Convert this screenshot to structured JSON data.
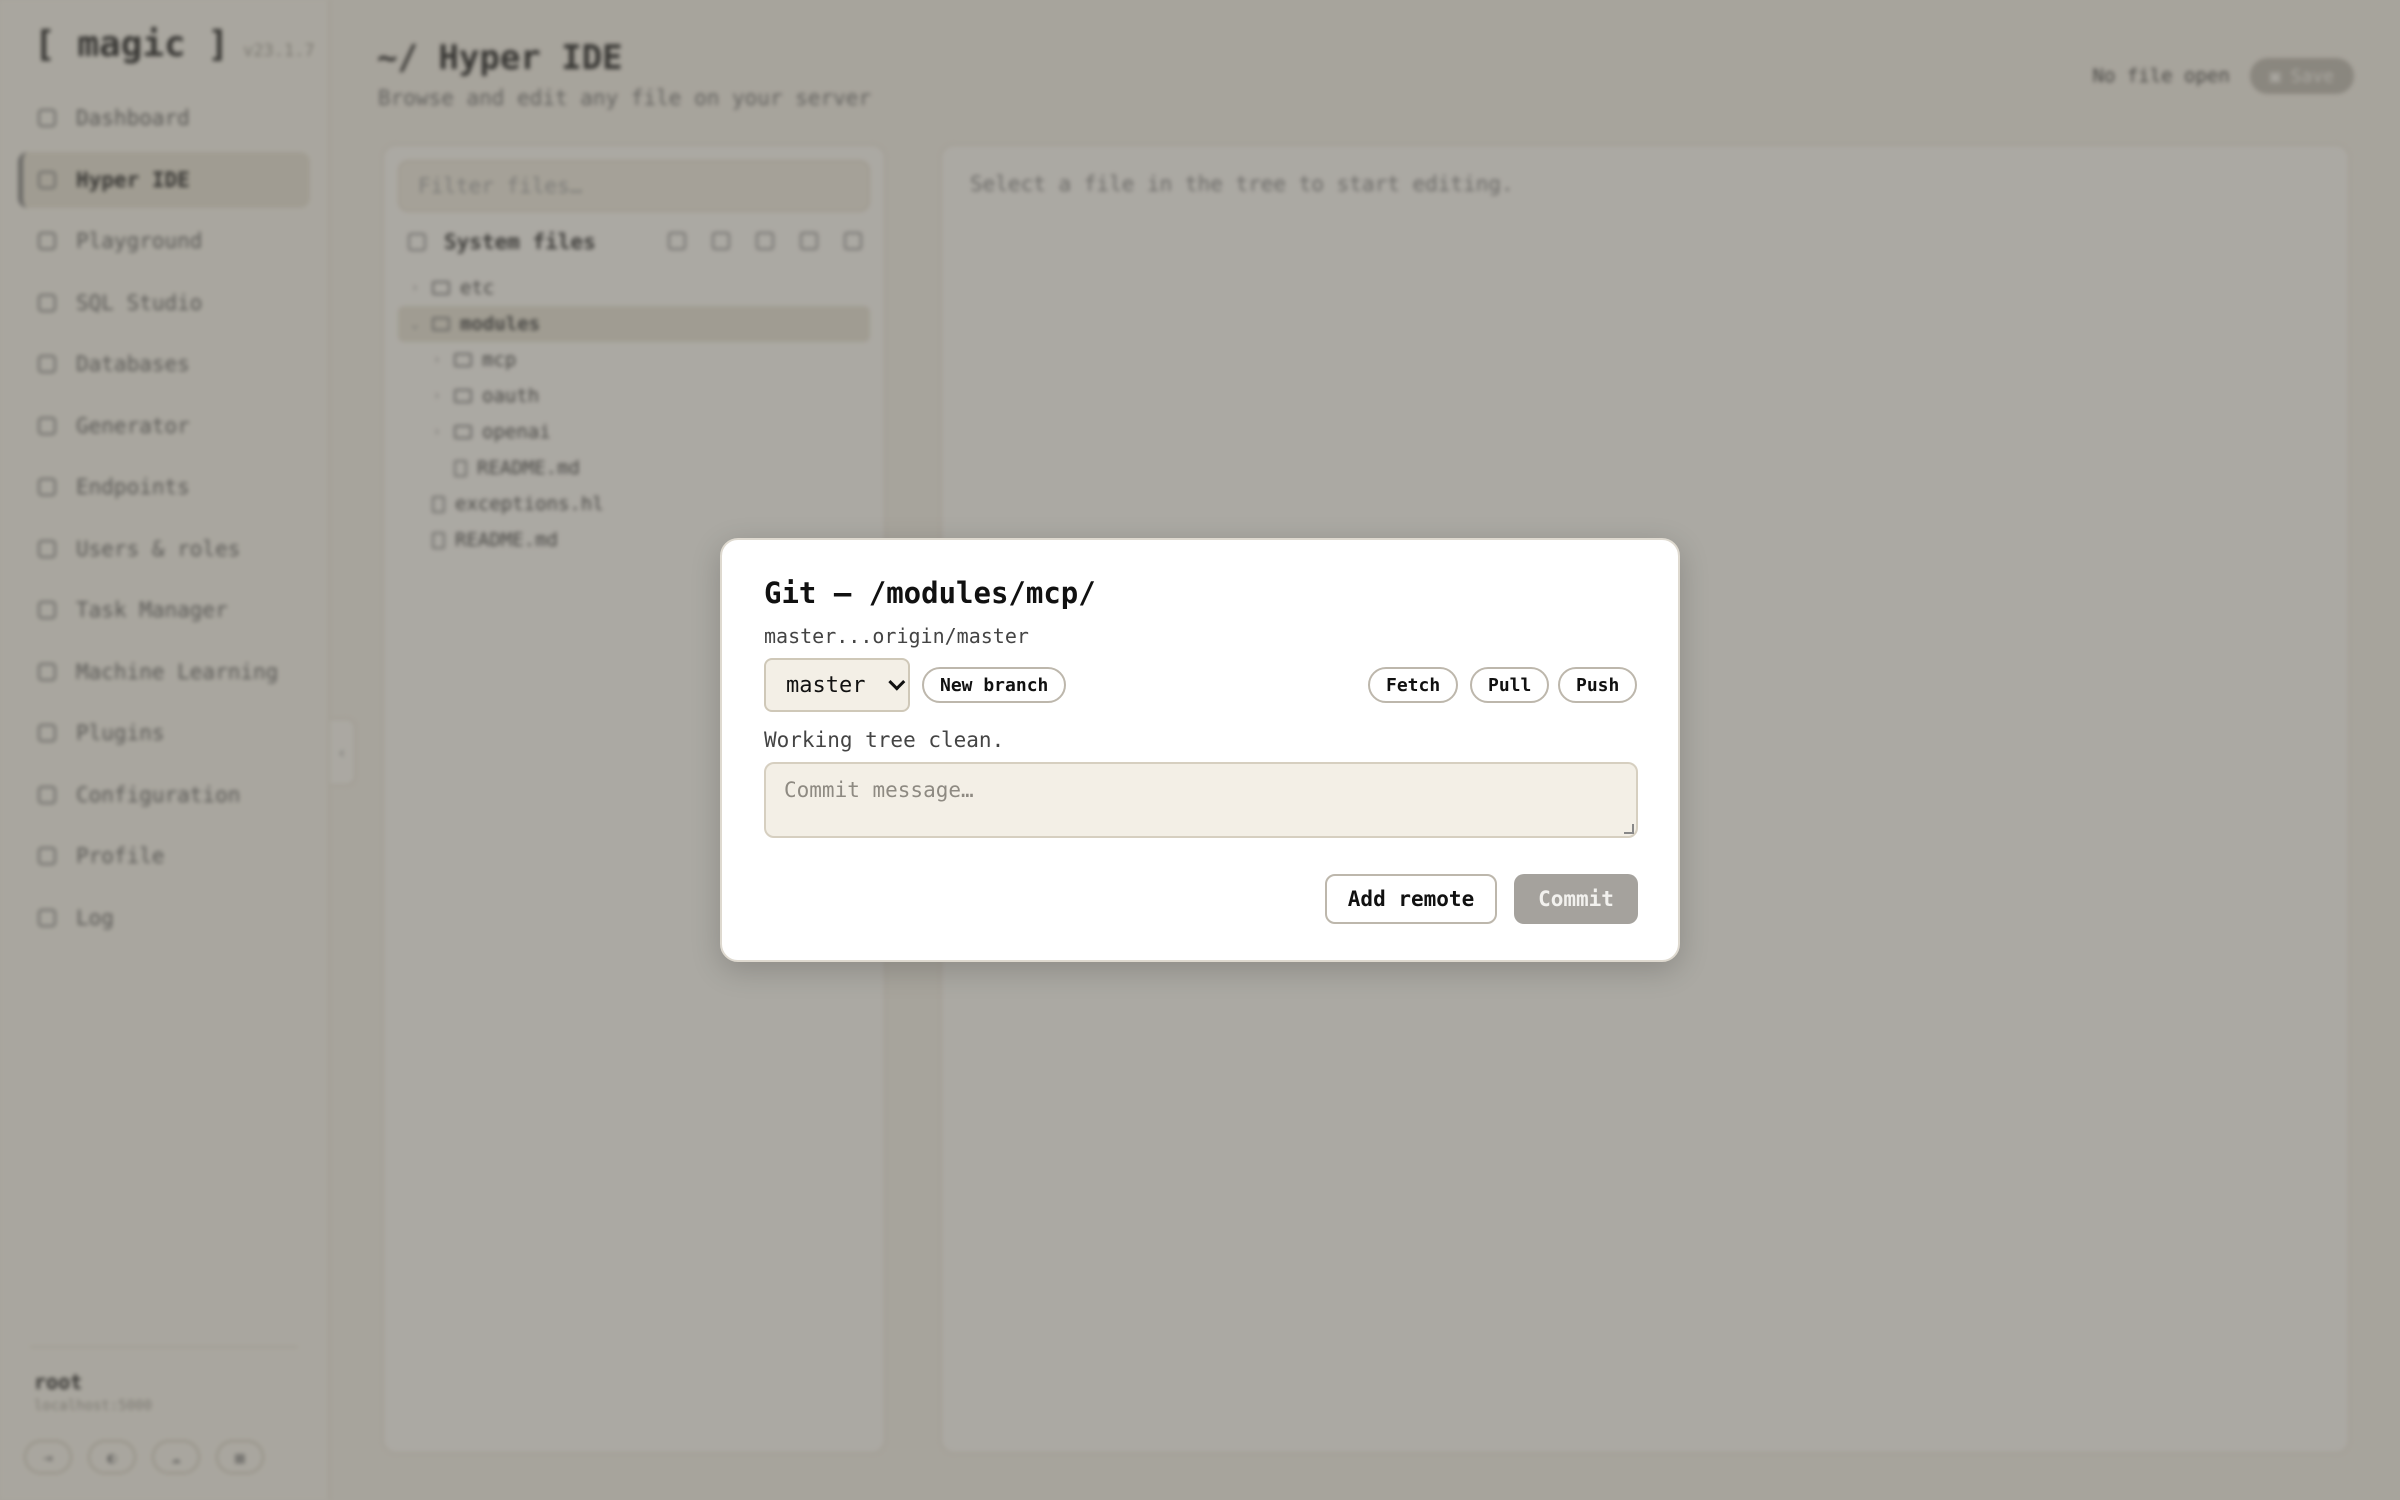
{
  "sidebar": {
    "brand": "[ magic ]",
    "version": "v23.1.7",
    "items": [
      {
        "label": "Dashboard",
        "icon": "home-icon"
      },
      {
        "label": "Hyper IDE",
        "icon": "file-icon",
        "active": true
      },
      {
        "label": "Playground",
        "icon": "play-icon"
      },
      {
        "label": "SQL Studio",
        "icon": "terminal-icon"
      },
      {
        "label": "Databases",
        "icon": "database-icon"
      },
      {
        "label": "Generator",
        "icon": "gear-icon"
      },
      {
        "label": "Endpoints",
        "icon": "arrows-icon"
      },
      {
        "label": "Users & roles",
        "icon": "user-icon"
      },
      {
        "label": "Task Manager",
        "icon": "clock-icon"
      },
      {
        "label": "Machine Learning",
        "icon": "diamond-icon"
      },
      {
        "label": "Plugins",
        "icon": "puzzle-icon"
      },
      {
        "label": "Configuration",
        "icon": "settings-icon"
      },
      {
        "label": "Profile",
        "icon": "profile-icon"
      },
      {
        "label": "Log",
        "icon": "log-icon"
      }
    ],
    "user": {
      "name": "root",
      "host": "localhost:5000"
    }
  },
  "header": {
    "title": "~/ Hyper IDE",
    "subtitle": "Browse and edit any file on your server",
    "status": "No file open",
    "save_label": "Save"
  },
  "files": {
    "filter_placeholder": "Filter files…",
    "system_files_label": "System files",
    "tree": [
      {
        "name": "etc",
        "type": "folder",
        "depth": 0,
        "expanded": false
      },
      {
        "name": "modules",
        "type": "folder",
        "depth": 0,
        "expanded": true,
        "selected": true
      },
      {
        "name": "mcp",
        "type": "folder",
        "depth": 1,
        "expanded": false
      },
      {
        "name": "oauth",
        "type": "folder",
        "depth": 1,
        "expanded": false
      },
      {
        "name": "openai",
        "type": "folder",
        "depth": 1,
        "expanded": false
      },
      {
        "name": "README.md",
        "type": "file",
        "depth": 1
      },
      {
        "name": "exceptions.hl",
        "type": "file",
        "depth": 0
      },
      {
        "name": "README.md",
        "type": "file",
        "depth": 0
      }
    ]
  },
  "editor": {
    "hint": "Select a file in the tree to start editing."
  },
  "git_modal": {
    "title": "Git — /modules/mcp/",
    "tracking": "master...origin/master",
    "branch_selected": "master",
    "new_branch_label": "New branch",
    "fetch_label": "Fetch",
    "pull_label": "Pull",
    "push_label": "Push",
    "status": "Working tree clean.",
    "commit_placeholder": "Commit message…",
    "add_remote_label": "Add remote",
    "commit_label": "Commit"
  },
  "colors": {
    "background": "#efeae0",
    "overlay": "#5f5d58",
    "modal_bg": "#ffffff",
    "commit_disabled": "#a5a29d"
  }
}
